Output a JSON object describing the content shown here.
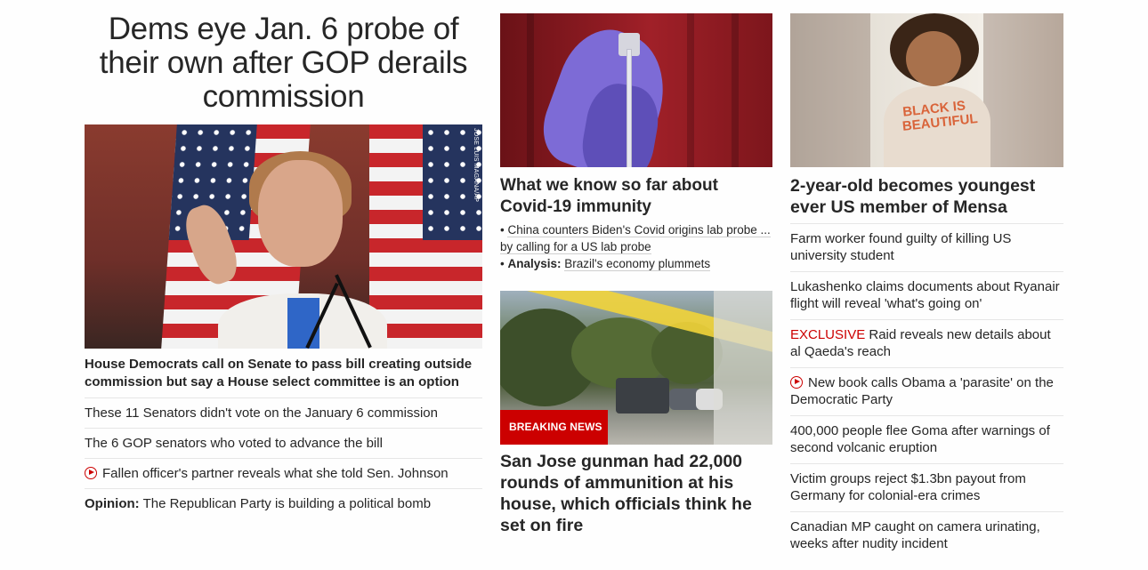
{
  "left": {
    "headline": "Dems eye Jan. 6 probe of their own after GOP derails commission",
    "image_credit": "JOSE LUIS MAGANA/AP",
    "story_title": "House Democrats call on Senate to pass bill creating outside commission but say a House select committee is an option",
    "links": [
      {
        "text": "These 11 Senators didn't vote on the January 6 commission"
      },
      {
        "text": "The 6 GOP senators who voted to advance the bill"
      },
      {
        "text": "Fallen officer's partner reveals what she told Sen. Johnson",
        "icon": "play-icon"
      },
      {
        "label": "Opinion:",
        "text": "The Republican Party is building a political bomb"
      }
    ]
  },
  "middle": {
    "top_story": {
      "title": "What we know so far about Covid-19 immunity",
      "sub_links": [
        {
          "text": "China counters Biden's Covid origins lab probe ... by calling for a US lab probe"
        },
        {
          "label": "Analysis:",
          "text": "Brazil's economy plummets"
        }
      ]
    },
    "bottom_story": {
      "badge": "BREAKING NEWS",
      "title": "San Jose gunman had 22,000 rounds of ammunition at his house, which officials think he set on fire"
    }
  },
  "right": {
    "top_story": {
      "title": "2-year-old becomes youngest ever US member of Mensa",
      "hoodie_text": "BLACK IS BEAUTIFUL"
    },
    "links": [
      {
        "text": "Farm worker found guilty of killing US university student"
      },
      {
        "text": "Lukashenko claims documents about Ryanair flight will reveal 'what's going on'"
      },
      {
        "label": "EXCLUSIVE",
        "text": "Raid reveals new details about al Qaeda's reach"
      },
      {
        "text": "New book calls Obama a 'parasite' on the Democratic Party",
        "icon": "play-icon"
      },
      {
        "text": "400,000 people flee Goma after warnings of second volcanic eruption"
      },
      {
        "text": "Victim groups reject $1.3bn payout from Germany for colonial-era crimes"
      },
      {
        "text": "Canadian MP caught on camera urinating, weeks after nudity incident"
      }
    ]
  },
  "colors": {
    "text": "#262626",
    "accent_red": "#cc0000",
    "divider": "#e6e6e6"
  }
}
